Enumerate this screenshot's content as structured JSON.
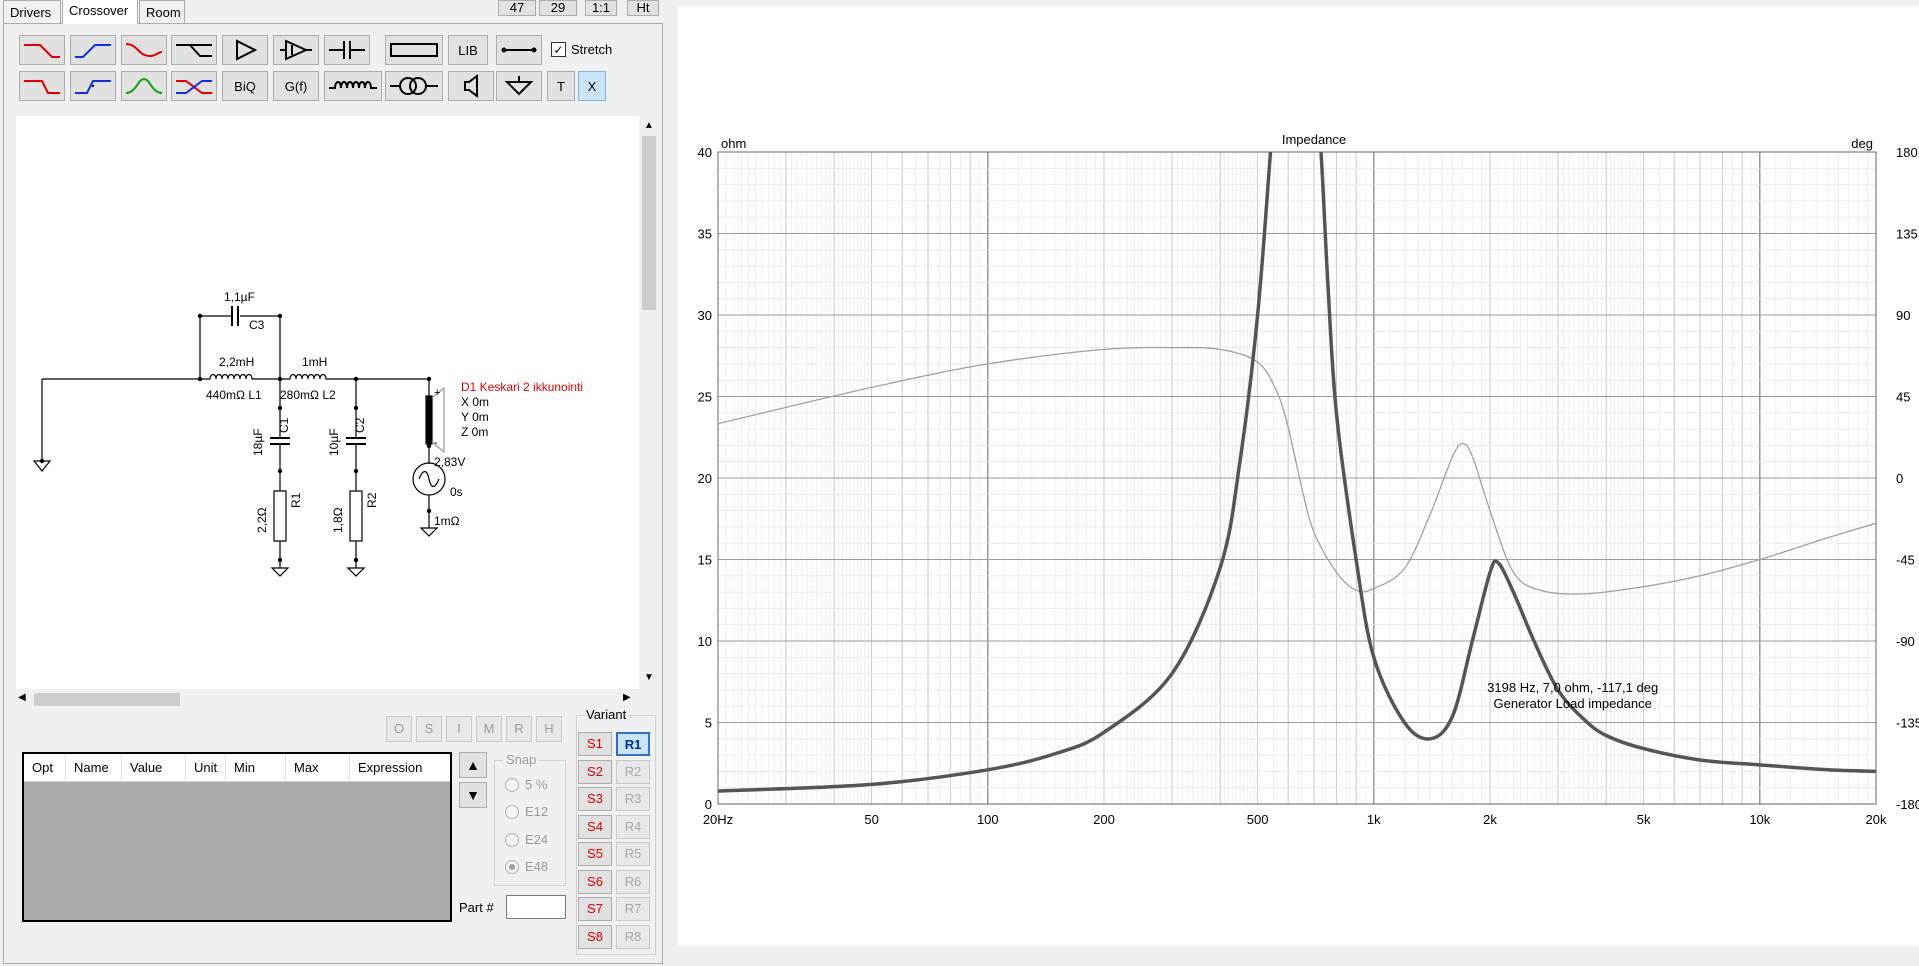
{
  "tabs": [
    {
      "label": "Drivers"
    },
    {
      "label": "Crossover"
    },
    {
      "label": "Room"
    }
  ],
  "top_buttons": [
    "47",
    "29",
    "1:1",
    "Ht"
  ],
  "toolbar": {
    "lib_label": "LIB",
    "biq_label": "BiQ",
    "gf_label": "G(f)",
    "t_label": "T",
    "x_label": "X",
    "stretch_label": "Stretch",
    "stretch_checked": true
  },
  "schematic": {
    "c3_value": "1,1µF",
    "c3_name": "C3",
    "l1_value": "2,2mH",
    "l1_res": "440mΩ L1",
    "l2_value": "1mH",
    "l2_res": "280mΩ L2",
    "c1_value": "18µF",
    "c1_name": "C1",
    "c2_value": "10µF",
    "c2_name": "C2",
    "r1_value": "2,2Ω",
    "r1_name": "R1",
    "r2_value": "1,8Ω",
    "r2_name": "R2",
    "driver_name": "D1 Keskari 2 ikkunointi",
    "driver_x": "X 0m",
    "driver_y": "Y 0m",
    "driver_z": "Z 0m",
    "driver_plus": "+",
    "driver_minus": "-",
    "gen_voltage": "2,83V",
    "gen_delay": "0s",
    "gen_res": "1mΩ",
    "driver_color": "#e00000"
  },
  "opt_buttons": [
    "O",
    "S",
    "I",
    "M",
    "R",
    "H"
  ],
  "param_table": {
    "columns": [
      "Opt",
      "Name",
      "Value",
      "Unit",
      "Min",
      "Max",
      "Expression"
    ]
  },
  "snap": {
    "title": "Snap",
    "options": [
      "5 %",
      "E12",
      "E24",
      "E48"
    ],
    "selected": "E48"
  },
  "part_label": "Part #",
  "part_value": "",
  "variant": {
    "title": "Variant",
    "s_buttons": [
      "S1",
      "S2",
      "S3",
      "S4",
      "S5",
      "S6",
      "S7",
      "S8"
    ],
    "r_buttons": [
      "R1",
      "R2",
      "R3",
      "R4",
      "R5",
      "R6",
      "R7",
      "R8"
    ],
    "active_r": "R1"
  },
  "chart_data": {
    "type": "line",
    "title": "Impedance",
    "ylabel_left": "ohm",
    "ylabel_right": "deg",
    "x_scale": "log",
    "xlim": [
      20,
      20000
    ],
    "ylim_left": [
      0,
      40
    ],
    "ylim_right": [
      -180,
      180
    ],
    "x_ticks": [
      {
        "v": 20,
        "label": "20Hz"
      },
      {
        "v": 50,
        "label": "50"
      },
      {
        "v": 100,
        "label": "100"
      },
      {
        "v": 200,
        "label": "200"
      },
      {
        "v": 500,
        "label": "500"
      },
      {
        "v": 1000,
        "label": "1k"
      },
      {
        "v": 2000,
        "label": "2k"
      },
      {
        "v": 5000,
        "label": "5k"
      },
      {
        "v": 10000,
        "label": "10k"
      },
      {
        "v": 20000,
        "label": "20k"
      }
    ],
    "y_left_ticks": [
      "0",
      "5",
      "10",
      "15",
      "20",
      "25",
      "30",
      "35",
      "40"
    ],
    "y_right_ticks": [
      "-180",
      "-135",
      "-90",
      "-45",
      "0",
      "45",
      "90",
      "135",
      "180"
    ],
    "grid": true,
    "series": [
      {
        "name": "Generator Load impedance",
        "axis": "left",
        "color": "#555555",
        "x": [
          20,
          50,
          100,
          150,
          200,
          300,
          400,
          450,
          500,
          540,
          560,
          580,
          700,
          730,
          760,
          800,
          900,
          1000,
          1200,
          1400,
          1600,
          1800,
          2000,
          2100,
          2300,
          2600,
          3000,
          3500,
          4000,
          5000,
          7000,
          10000,
          15000,
          20000
        ],
        "y": [
          0.8,
          1.2,
          2.1,
          3.1,
          4.4,
          8.0,
          14.5,
          21.0,
          30.0,
          40.0,
          45.0,
          45.0,
          45.0,
          40.0,
          32.0,
          24.0,
          15.0,
          9.0,
          5.0,
          4.0,
          5.4,
          10.0,
          14.2,
          14.8,
          13.0,
          10.0,
          7.0,
          5.2,
          4.2,
          3.4,
          2.7,
          2.4,
          2.1,
          2.0
        ]
      },
      {
        "name": "Phase",
        "axis": "right",
        "color": "#a0a0a0",
        "x": [
          20,
          50,
          100,
          200,
          300,
          400,
          500,
          560,
          600,
          650,
          700,
          800,
          900,
          1000,
          1200,
          1400,
          1600,
          1700,
          1800,
          2000,
          2300,
          2700,
          3500,
          5000,
          7000,
          10000,
          15000,
          20000
        ],
        "y": [
          30,
          50,
          63,
          71,
          72,
          71,
          64,
          48,
          28,
          -5,
          -30,
          -52,
          -62,
          -61,
          -50,
          -20,
          12,
          19,
          12,
          -18,
          -52,
          -62,
          -64,
          -60,
          -54,
          -45,
          -33,
          -25
        ]
      }
    ],
    "annotation_line1": "3198 Hz, 7,0 ohm, -117,1 deg",
    "annotation_line2": "Generator Load impedance"
  }
}
